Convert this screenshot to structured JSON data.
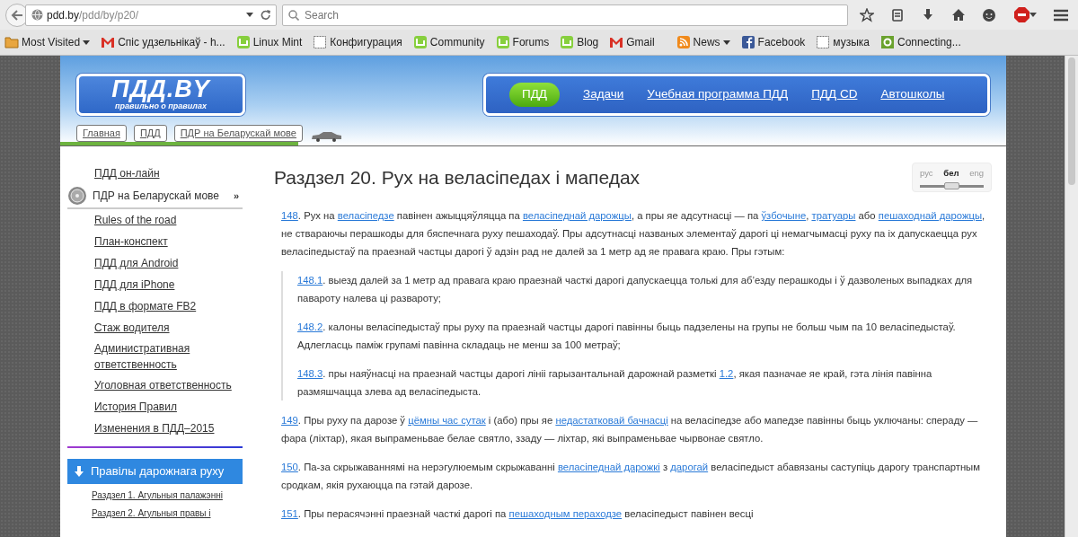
{
  "browser": {
    "url_host": "pdd.by",
    "url_path": "/pdd/by/p20/",
    "search_placeholder": "Search"
  },
  "bookmarks": [
    {
      "label": "Most Visited",
      "kind": "folder",
      "dropdown": true
    },
    {
      "label": "Спіс удзельнікаў - h...",
      "kind": "mail",
      "dropdown": false
    },
    {
      "label": "Linux Mint",
      "kind": "mint",
      "dropdown": false
    },
    {
      "label": "Конфигурация",
      "kind": "blank",
      "dropdown": false
    },
    {
      "label": "Community",
      "kind": "mint",
      "dropdown": false
    },
    {
      "label": "Forums",
      "kind": "mint",
      "dropdown": false
    },
    {
      "label": "Blog",
      "kind": "mint",
      "dropdown": false
    },
    {
      "label": "Gmail",
      "kind": "mail",
      "dropdown": false
    },
    {
      "label": "News",
      "kind": "rss",
      "dropdown": true
    },
    {
      "label": "Facebook",
      "kind": "facebook",
      "dropdown": false
    },
    {
      "label": "музыка",
      "kind": "blank",
      "dropdown": false
    },
    {
      "label": "Connecting...",
      "kind": "loading",
      "dropdown": false
    }
  ],
  "site": {
    "logo_title": "ПДД.BY",
    "logo_tagline": "правильно о правилах",
    "breadcrumbs": [
      "Главная",
      "ПДД",
      "ПДР на Беларускай мове"
    ],
    "nav": [
      {
        "label": "ПДД",
        "selected": true
      },
      {
        "label": "Задачи",
        "selected": false
      },
      {
        "label": "Учебная программа ПДД",
        "selected": false
      },
      {
        "label": "ПДД CD",
        "selected": false
      },
      {
        "label": "Автошколы",
        "selected": false
      }
    ]
  },
  "sidebar": {
    "items": [
      {
        "label": "ПДД он-лайн",
        "selected": false
      },
      {
        "label": "ПДР на Беларускай мове",
        "selected": true,
        "suffix": "»"
      },
      {
        "label": "Rules of the road",
        "selected": false
      },
      {
        "label": "План-конспект",
        "selected": false
      },
      {
        "label": "ПДД для Android",
        "selected": false
      },
      {
        "label": "ПДД для iPhone",
        "selected": false
      },
      {
        "label": "ПДД в формате FB2",
        "selected": false
      },
      {
        "label": "Стаж водителя",
        "selected": false
      },
      {
        "label": "Административная ответственность",
        "selected": false
      },
      {
        "label": "Уголовная ответственность",
        "selected": false
      },
      {
        "label": "История Правил",
        "selected": false
      },
      {
        "label": "Изменения в ПДД–2015",
        "selected": false
      }
    ],
    "section": {
      "title": "Правілы дарожнага руху",
      "items": [
        "Раздзел 1. Агульныя палажэнні",
        "Раздзел 2. Агульныя правы і"
      ]
    }
  },
  "language": [
    {
      "label": "рус",
      "selected": false
    },
    {
      "label": "бел",
      "selected": true
    },
    {
      "label": "eng",
      "selected": false
    }
  ],
  "heading": "Раздзел 20. Рух на веласіпедах і мапедах",
  "clauses": [
    {
      "kind": "clause",
      "segments": [
        {
          "kind": "link",
          "text": "148"
        },
        {
          "kind": "text",
          "text": ". Рух на "
        },
        {
          "kind": "link",
          "text": "веласіпедзе"
        },
        {
          "kind": "text",
          "text": " павінен ажыццяўляцца па "
        },
        {
          "kind": "link",
          "text": "веласіпеднай дарожцы"
        },
        {
          "kind": "text",
          "text": ", а пры яе адсутнасці — па "
        },
        {
          "kind": "link",
          "text": "ўзбочыне"
        },
        {
          "kind": "text",
          "text": ", "
        },
        {
          "kind": "link",
          "text": "тратуары"
        },
        {
          "kind": "text",
          "text": " або "
        },
        {
          "kind": "link",
          "text": "пешаходнай дарожцы"
        },
        {
          "kind": "text",
          "text": ", не ствараючы перашкоды для бяспечнага руху пешаходаў. Пры адсутнасці названых элементаў дарогі ці немагчымасці руху па іх дапускаецца рух веласіпедыстаў па праезнай частцы дарогі ў адзін рад не далей за 1 метр ад яе правага краю. Пры гэтым:"
        }
      ]
    },
    {
      "kind": "subclause",
      "segments": [
        {
          "kind": "link",
          "text": "148.1"
        },
        {
          "kind": "text",
          "text": ". выезд далей за 1 метр ад правага краю праезнай часткі дарогі дапускаецца толькі для аб’езду перашкоды і ў дазволеных выпадках для павароту налева ці развароту;"
        }
      ]
    },
    {
      "kind": "subclause",
      "segments": [
        {
          "kind": "link",
          "text": "148.2"
        },
        {
          "kind": "text",
          "text": ". калоны веласіпедыстаў пры руху па праезнай частцы дарогі павінны быць падзелены на групы не больш чым па 10 веласіпедыстаў. Адлегласць паміж групамі павінна складаць не менш за 100 метраў;"
        }
      ]
    },
    {
      "kind": "subclause",
      "segments": [
        {
          "kind": "link",
          "text": "148.3"
        },
        {
          "kind": "text",
          "text": ". пры наяўнасці на праезнай частцы дарогі лініі гарызантальнай дарожнай разметкі "
        },
        {
          "kind": "link",
          "text": "1.2"
        },
        {
          "kind": "text",
          "text": ", якая пазначае яе край, гэта лінія павінна размяшчацца злева ад веласіпедыста."
        }
      ]
    },
    {
      "kind": "clause",
      "segments": [
        {
          "kind": "link",
          "text": "149"
        },
        {
          "kind": "text",
          "text": ". Пры руху па дарозе ў "
        },
        {
          "kind": "link",
          "text": "цёмны час сутак"
        },
        {
          "kind": "text",
          "text": " і (або) пры яе "
        },
        {
          "kind": "link",
          "text": "недастатковай бачнасці"
        },
        {
          "kind": "text",
          "text": " на веласіпедзе або мапедзе павінны быць уключаны: спераду — фара (ліхтар), якая выпраменьвае белае святло, ззаду — ліхтар, які выпраменьвае чырвонае святло."
        }
      ]
    },
    {
      "kind": "clause",
      "segments": [
        {
          "kind": "link",
          "text": "150"
        },
        {
          "kind": "text",
          "text": ". Па-за скрыжаваннямі на нерэгулюемым скрыжаванні "
        },
        {
          "kind": "link",
          "text": "веласіпеднай дарожкі"
        },
        {
          "kind": "text",
          "text": " з "
        },
        {
          "kind": "link",
          "text": "дарогай"
        },
        {
          "kind": "text",
          "text": " веласіпедыст абавязаны саступіць дарогу транспартным сродкам, якія рухаюцца па гэтай дарозе."
        }
      ]
    },
    {
      "kind": "clause",
      "segments": [
        {
          "kind": "link",
          "text": "151"
        },
        {
          "kind": "text",
          "text": ". Пры перасячэнні праезнай часткі дарогі па "
        },
        {
          "kind": "link",
          "text": "пешаходным пераходзе"
        },
        {
          "kind": "text",
          "text": " веласіпедыст павінен весці"
        }
      ]
    }
  ]
}
